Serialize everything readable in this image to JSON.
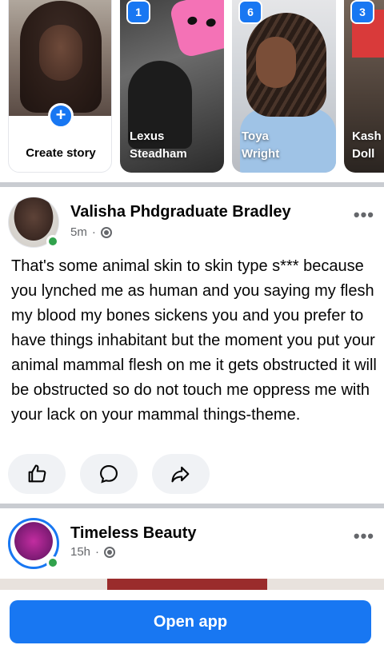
{
  "stories": {
    "create_label": "Create story",
    "cards": [
      {
        "count": "1",
        "name_line1": "Lexus",
        "name_line2": "Steadham"
      },
      {
        "count": "6",
        "name_line1": "Toya",
        "name_line2": "Wright"
      },
      {
        "count": "3",
        "name_line1": "Kash",
        "name_line2": "Doll"
      }
    ]
  },
  "posts": [
    {
      "author": "Valisha Phdgraduate Bradley",
      "time": "5m",
      "separator": "·",
      "privacy_icon": "globe-icon",
      "online": true,
      "text": "That's some animal skin to skin type s*** because you lynched me as human and you saying my flesh my blood my bones sickens you and you prefer to have things inhabitant but the moment you put your animal mammal flesh on me it gets obstructed it will be obstructed so do not touch me oppress me with your lack on your mammal things-theme.",
      "actions": [
        "like-icon",
        "comment-icon",
        "share-icon"
      ]
    },
    {
      "author": "Timeless Beauty",
      "time": "15h",
      "separator": "·",
      "privacy_icon": "globe-icon",
      "online": true
    }
  ],
  "cta": {
    "label": "Open app"
  },
  "colors": {
    "accent": "#1877f2",
    "online": "#31a24c",
    "muted": "#65676b",
    "divider": "#c9ccd1"
  }
}
